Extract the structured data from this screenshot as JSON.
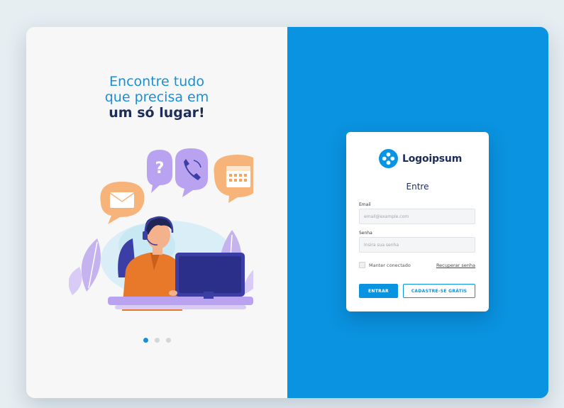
{
  "hero": {
    "line1": "Encontre tudo",
    "line2": "que precisa em",
    "line3": "um só lugar!"
  },
  "carousel": {
    "total": 3,
    "active": 1
  },
  "login": {
    "brand": "Logoipsum",
    "title": "Entre",
    "email_label": "Email",
    "email_placeholder": "email@example.com",
    "password_label": "Senha",
    "password_placeholder": "Insira sua senha",
    "remember_label": "Manter conectado",
    "remember_checked": false,
    "recover_link": "Recuperar senha",
    "enter_button": "ENTRAR",
    "signup_button": "CADASTRE-SE GRÁTIS"
  },
  "colors": {
    "primary": "#0a93e0",
    "navy": "#1c2c5b",
    "headline_blue": "#1a8fd4",
    "bubble_orange": "#f7b47a",
    "bubble_purple": "#b9a3f0"
  },
  "icons": [
    "envelope-icon",
    "question-icon",
    "phone-icon",
    "calendar-icon",
    "logo-icon",
    "checkbox-icon"
  ]
}
